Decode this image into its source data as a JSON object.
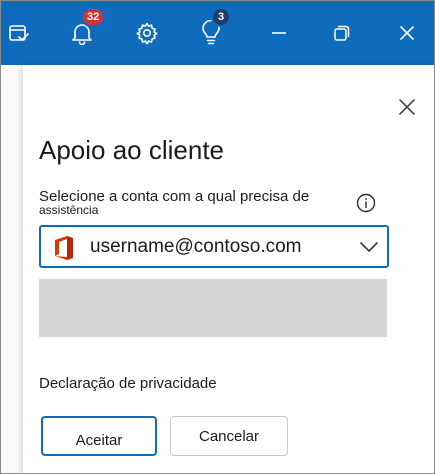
{
  "titlebar": {
    "icons": {
      "tasks": "calendar-check-icon",
      "notifications": "bell-icon",
      "settings": "gear-icon",
      "tips": "lightbulb-icon",
      "minimize": "minimize-icon",
      "restore": "restore-icon",
      "close": "close-icon"
    },
    "notifications_badge": "32",
    "tips_badge": "3",
    "color": "#0f6cbd"
  },
  "panel": {
    "title": "Apoio ao cliente",
    "account_label_line1": "Selecione a conta com a qual precisa de",
    "account_label_line2": "assistência",
    "account_select": {
      "value": "username@contoso.com",
      "icon": "office-icon"
    },
    "privacy_link": "Declaração de privacidade",
    "accept_label": "Aceitar",
    "cancel_label": "Cancelar"
  }
}
